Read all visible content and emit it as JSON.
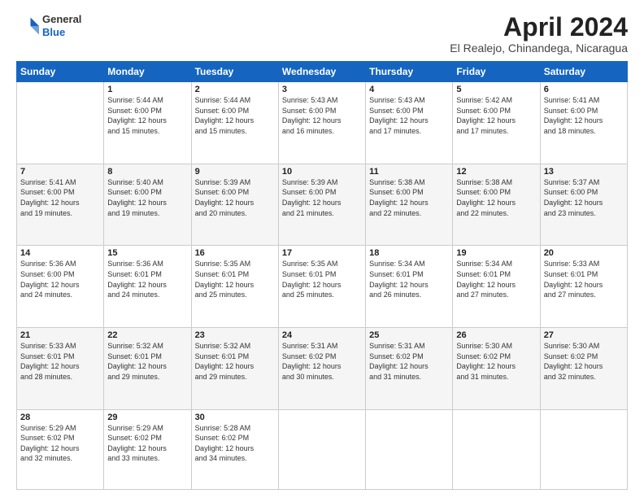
{
  "logo": {
    "general": "General",
    "blue": "Blue"
  },
  "title": "April 2024",
  "location": "El Realejo, Chinandega, Nicaragua",
  "weekdays": [
    "Sunday",
    "Monday",
    "Tuesday",
    "Wednesday",
    "Thursday",
    "Friday",
    "Saturday"
  ],
  "weeks": [
    [
      {
        "day": "",
        "info": ""
      },
      {
        "day": "1",
        "info": "Sunrise: 5:44 AM\nSunset: 6:00 PM\nDaylight: 12 hours\nand 15 minutes."
      },
      {
        "day": "2",
        "info": "Sunrise: 5:44 AM\nSunset: 6:00 PM\nDaylight: 12 hours\nand 15 minutes."
      },
      {
        "day": "3",
        "info": "Sunrise: 5:43 AM\nSunset: 6:00 PM\nDaylight: 12 hours\nand 16 minutes."
      },
      {
        "day": "4",
        "info": "Sunrise: 5:43 AM\nSunset: 6:00 PM\nDaylight: 12 hours\nand 17 minutes."
      },
      {
        "day": "5",
        "info": "Sunrise: 5:42 AM\nSunset: 6:00 PM\nDaylight: 12 hours\nand 17 minutes."
      },
      {
        "day": "6",
        "info": "Sunrise: 5:41 AM\nSunset: 6:00 PM\nDaylight: 12 hours\nand 18 minutes."
      }
    ],
    [
      {
        "day": "7",
        "info": "Sunrise: 5:41 AM\nSunset: 6:00 PM\nDaylight: 12 hours\nand 19 minutes."
      },
      {
        "day": "8",
        "info": "Sunrise: 5:40 AM\nSunset: 6:00 PM\nDaylight: 12 hours\nand 19 minutes."
      },
      {
        "day": "9",
        "info": "Sunrise: 5:39 AM\nSunset: 6:00 PM\nDaylight: 12 hours\nand 20 minutes."
      },
      {
        "day": "10",
        "info": "Sunrise: 5:39 AM\nSunset: 6:00 PM\nDaylight: 12 hours\nand 21 minutes."
      },
      {
        "day": "11",
        "info": "Sunrise: 5:38 AM\nSunset: 6:00 PM\nDaylight: 12 hours\nand 22 minutes."
      },
      {
        "day": "12",
        "info": "Sunrise: 5:38 AM\nSunset: 6:00 PM\nDaylight: 12 hours\nand 22 minutes."
      },
      {
        "day": "13",
        "info": "Sunrise: 5:37 AM\nSunset: 6:00 PM\nDaylight: 12 hours\nand 23 minutes."
      }
    ],
    [
      {
        "day": "14",
        "info": "Sunrise: 5:36 AM\nSunset: 6:00 PM\nDaylight: 12 hours\nand 24 minutes."
      },
      {
        "day": "15",
        "info": "Sunrise: 5:36 AM\nSunset: 6:01 PM\nDaylight: 12 hours\nand 24 minutes."
      },
      {
        "day": "16",
        "info": "Sunrise: 5:35 AM\nSunset: 6:01 PM\nDaylight: 12 hours\nand 25 minutes."
      },
      {
        "day": "17",
        "info": "Sunrise: 5:35 AM\nSunset: 6:01 PM\nDaylight: 12 hours\nand 25 minutes."
      },
      {
        "day": "18",
        "info": "Sunrise: 5:34 AM\nSunset: 6:01 PM\nDaylight: 12 hours\nand 26 minutes."
      },
      {
        "day": "19",
        "info": "Sunrise: 5:34 AM\nSunset: 6:01 PM\nDaylight: 12 hours\nand 27 minutes."
      },
      {
        "day": "20",
        "info": "Sunrise: 5:33 AM\nSunset: 6:01 PM\nDaylight: 12 hours\nand 27 minutes."
      }
    ],
    [
      {
        "day": "21",
        "info": "Sunrise: 5:33 AM\nSunset: 6:01 PM\nDaylight: 12 hours\nand 28 minutes."
      },
      {
        "day": "22",
        "info": "Sunrise: 5:32 AM\nSunset: 6:01 PM\nDaylight: 12 hours\nand 29 minutes."
      },
      {
        "day": "23",
        "info": "Sunrise: 5:32 AM\nSunset: 6:01 PM\nDaylight: 12 hours\nand 29 minutes."
      },
      {
        "day": "24",
        "info": "Sunrise: 5:31 AM\nSunset: 6:02 PM\nDaylight: 12 hours\nand 30 minutes."
      },
      {
        "day": "25",
        "info": "Sunrise: 5:31 AM\nSunset: 6:02 PM\nDaylight: 12 hours\nand 31 minutes."
      },
      {
        "day": "26",
        "info": "Sunrise: 5:30 AM\nSunset: 6:02 PM\nDaylight: 12 hours\nand 31 minutes."
      },
      {
        "day": "27",
        "info": "Sunrise: 5:30 AM\nSunset: 6:02 PM\nDaylight: 12 hours\nand 32 minutes."
      }
    ],
    [
      {
        "day": "28",
        "info": "Sunrise: 5:29 AM\nSunset: 6:02 PM\nDaylight: 12 hours\nand 32 minutes."
      },
      {
        "day": "29",
        "info": "Sunrise: 5:29 AM\nSunset: 6:02 PM\nDaylight: 12 hours\nand 33 minutes."
      },
      {
        "day": "30",
        "info": "Sunrise: 5:28 AM\nSunset: 6:02 PM\nDaylight: 12 hours\nand 34 minutes."
      },
      {
        "day": "",
        "info": ""
      },
      {
        "day": "",
        "info": ""
      },
      {
        "day": "",
        "info": ""
      },
      {
        "day": "",
        "info": ""
      }
    ]
  ]
}
